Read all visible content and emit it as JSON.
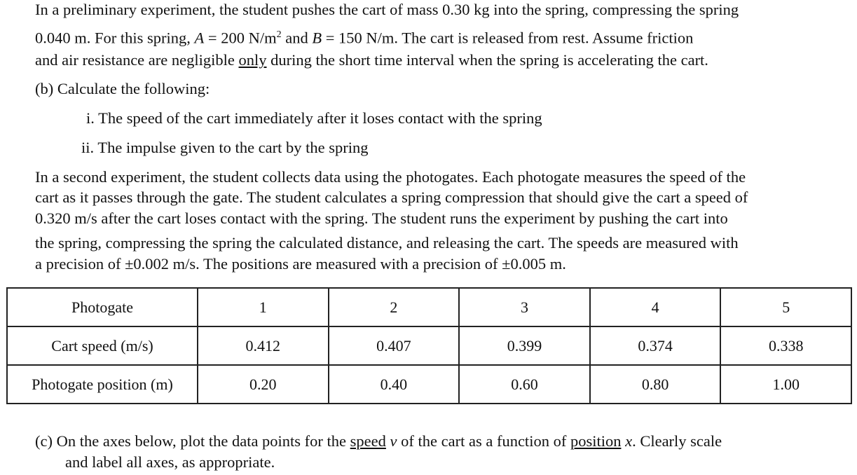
{
  "intro": {
    "line1": "In a preliminary experiment, the student pushes the cart of mass 0.30 kg into the spring, compressing the spring",
    "line2_a": "0.040 m. For this spring, ",
    "line2_A": "A",
    "line2_b": " = 200 N/m",
    "line2_sup": "2",
    "line2_c": " and ",
    "line2_B": "B",
    "line2_d": " = 150 N/m. The cart is released from rest. Assume friction",
    "line3_a": "and air resistance are negligible ",
    "line3_only": "only",
    "line3_b": " during the short time interval when the spring is accelerating the cart."
  },
  "part_b": {
    "label": "(b) Calculate the following:",
    "item_i": "i. The speed of the cart immediately after it loses contact with the spring",
    "item_ii": "ii. The impulse given to the cart by the spring"
  },
  "second": {
    "line1": "In a second experiment, the student collects data using the photogates. Each photogate measures the speed of the",
    "line2": "cart as it passes through the gate. The student calculates a spring compression that should give the cart a speed of",
    "line3": "0.320 m/s after the cart loses contact with the spring. The student runs the experiment by pushing the cart into",
    "line4": "the spring, compressing the spring the calculated distance, and releasing the cart. The speeds are measured with",
    "line5": "a precision of ±0.002 m/s. The positions are measured with a precision of ±0.005 m."
  },
  "table": {
    "header_label": "Photogate",
    "header": [
      "1",
      "2",
      "3",
      "4",
      "5"
    ],
    "speed_label": "Cart speed (m/s)",
    "speed": [
      "0.412",
      "0.407",
      "0.399",
      "0.374",
      "0.338"
    ],
    "position_label": "Photogate position (m)",
    "position": [
      "0.20",
      "0.40",
      "0.60",
      "0.80",
      "1.00"
    ]
  },
  "part_c": {
    "a": "(c) On the axes below, plot the data points for the ",
    "speed": "speed",
    "v": "v",
    "b": " of the cart as a function of ",
    "position": "position",
    "x": "x",
    "c": ". Clearly scale",
    "line2": "and label all axes, as appropriate."
  }
}
